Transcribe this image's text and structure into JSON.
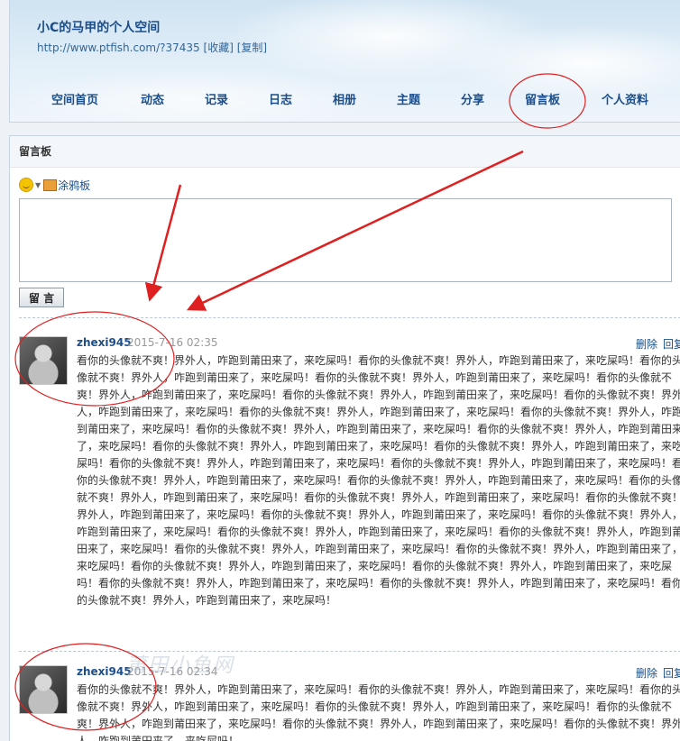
{
  "header": {
    "title": "小C的马甲的个人空间",
    "url": "http://www.ptfish.com/?37435",
    "favorite_label": "[收藏]",
    "copy_label": "[复制]"
  },
  "nav": {
    "items": [
      "空间首页",
      "动态",
      "记录",
      "日志",
      "相册",
      "主题",
      "分享",
      "留言板",
      "个人资料"
    ]
  },
  "board": {
    "title": "留言板",
    "graffiti_label": "涂鸦板",
    "submit_label": "留 言"
  },
  "entries": [
    {
      "author": "zhexi945",
      "time": "2015-7-16 02:35",
      "delete_label": "删除",
      "reply_label": "回复",
      "text": "看你的头像就不爽！界外人，咋跑到莆田来了，来吃屎吗！看你的头像就不爽！界外人，咋跑到莆田来了，来吃屎吗！看你的头像就不爽！界外人，咋跑到莆田来了，来吃屎吗！看你的头像就不爽！界外人，咋跑到莆田来了，来吃屎吗！看你的头像就不爽！界外人，咋跑到莆田来了，来吃屎吗！看你的头像就不爽！界外人，咋跑到莆田来了，来吃屎吗！看你的头像就不爽！界外人，咋跑到莆田来了，来吃屎吗！看你的头像就不爽！界外人，咋跑到莆田来了，来吃屎吗！看你的头像就不爽！界外人，咋跑到莆田来了，来吃屎吗！看你的头像就不爽！界外人，咋跑到莆田来了，来吃屎吗！看你的头像就不爽！界外人，咋跑到莆田来了，来吃屎吗！看你的头像就不爽！界外人，咋跑到莆田来了，来吃屎吗！看你的头像就不爽！界外人，咋跑到莆田来了，来吃屎吗！看你的头像就不爽！界外人，咋跑到莆田来了，来吃屎吗！看你的头像就不爽！界外人，咋跑到莆田来了，来吃屎吗！看你的头像就不爽！界外人，咋跑到莆田来了，来吃屎吗！看你的头像就不爽！界外人，咋跑到莆田来了，来吃屎吗！看你的头像就不爽！界外人，咋跑到莆田来了，来吃屎吗！看你的头像就不爽！界外人，咋跑到莆田来了，来吃屎吗！看你的头像就不爽！界外人，咋跑到莆田来了，来吃屎吗！看你的头像就不爽！界外人，咋跑到莆田来了，来吃屎吗！看你的头像就不爽！界外人，咋跑到莆田来了，来吃屎吗！看你的头像就不爽！界外人，咋跑到莆田来了，来吃屎吗！看你的头像就不爽！界外人，咋跑到莆田来了，来吃屎吗！看你的头像就不爽！界外人，咋跑到莆田来了，来吃屎吗！看你的头像就不爽！界外人，咋跑到莆田来了，来吃屎吗！看你的头像就不爽！界外人，咋跑到莆田来了，来吃屎吗！看你的头像就不爽！界外人，咋跑到莆田来了，来吃屎吗！看你的头像就不爽！界外人，咋跑到莆田来了，来吃屎吗！看你的头像就不爽！界外人，咋跑到莆田来了，来吃屎吗！看你的头像就不爽！界外人，咋跑到莆田来了，来吃屎吗！"
    },
    {
      "author": "zhexi945",
      "time": "2015-7-16 02:34",
      "delete_label": "删除",
      "reply_label": "回复",
      "text": "看你的头像就不爽！界外人，咋跑到莆田来了，来吃屎吗！看你的头像就不爽！界外人，咋跑到莆田来了，来吃屎吗！看你的头像就不爽！界外人，咋跑到莆田来了，来吃屎吗！看你的头像就不爽！界外人，咋跑到莆田来了，来吃屎吗！看你的头像就不爽！界外人，咋跑到莆田来了，来吃屎吗！看你的头像就不爽！界外人，咋跑到莆田来了，来吃屎吗！看你的头像就不爽！界外人，咋跑到莆田来了，来吃屎吗！"
    }
  ],
  "watermark": "莆田小鱼网",
  "colors": {
    "link": "#1b4e8a",
    "annotation": "#e02020"
  }
}
